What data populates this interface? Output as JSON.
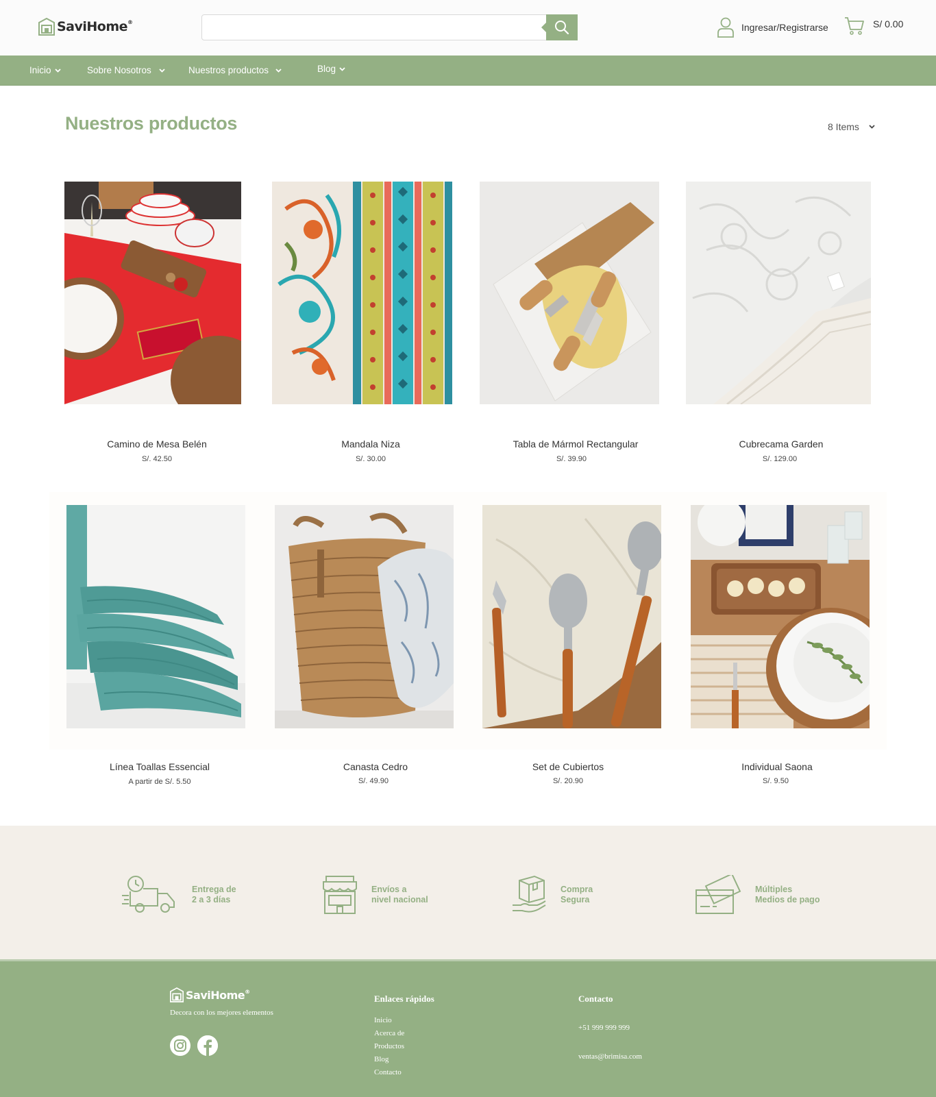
{
  "header": {
    "brand": "SaviHome",
    "brand_mark": "®",
    "search": {
      "value": "",
      "placeholder": ""
    },
    "account_label": "Ingresar/Registrarse",
    "cart_total": "S/ 0.00"
  },
  "nav": {
    "items": [
      {
        "label": "Inicio"
      },
      {
        "label": "Sobre Nosotros"
      },
      {
        "label": "Nuestros productos"
      },
      {
        "label": "Blog"
      }
    ]
  },
  "main": {
    "title": "Nuestros productos",
    "items_select": "8 Items"
  },
  "products": [
    {
      "name": "Camino de Mesa Belén",
      "price": "S/. 42.50"
    },
    {
      "name": "Mandala Niza",
      "price": "S/. 30.00"
    },
    {
      "name": "Tabla de Mármol Rectangular",
      "price": "S/. 39.90"
    },
    {
      "name": "Cubrecama Garden",
      "price": "S/. 129.00"
    },
    {
      "name": "Línea Toallas Essencial",
      "price": "A partir de S/. 5.50"
    },
    {
      "name": "Canasta Cedro",
      "price": "S/. 49.90"
    },
    {
      "name": "Set de Cubiertos",
      "price": "S/. 20.90"
    },
    {
      "name": "Individual Saona",
      "price": "S/. 9.50"
    }
  ],
  "benefits": [
    {
      "line1": "Entrega de",
      "line2": "2 a 3 días",
      "icon": "delivery-truck-icon"
    },
    {
      "line1": "Envíos a",
      "line2": "nivel nacional",
      "icon": "store-icon"
    },
    {
      "line1": "Compra",
      "line2": "Segura",
      "icon": "secure-box-icon"
    },
    {
      "line1": "Múltiples",
      "line2": "Medios de pago",
      "icon": "credit-card-icon"
    }
  ],
  "footer": {
    "brand": "SaviHome",
    "brand_mark": "®",
    "tagline": "Decora con los mejores elementos",
    "social": [
      "instagram-icon",
      "facebook-icon"
    ],
    "links_heading": "Enlaces rápidos",
    "links": [
      "Inicio",
      "Acerca de",
      "Productos",
      "Blog",
      "Contacto"
    ],
    "contact_heading": "Contacto",
    "phone": "+51 999 999 999",
    "email": "ventas@brimisa.com"
  },
  "colors": {
    "accent_green": "#94b084",
    "beige_band": "#f3efe9",
    "header_bg": "#fbfbfb"
  }
}
